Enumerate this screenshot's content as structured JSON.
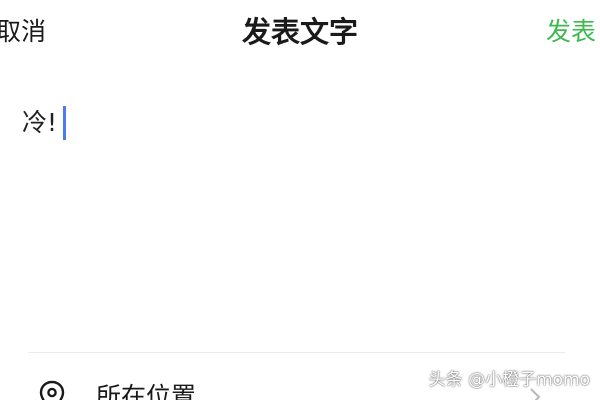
{
  "header": {
    "cancel_label": "取消",
    "title": "发表文字",
    "publish_label": "发表"
  },
  "editor": {
    "text": "冷!"
  },
  "location": {
    "label": "所在位置"
  },
  "watermark": {
    "text": "头条 @小橙子momo"
  },
  "colors": {
    "accent_green": "#3cb94f",
    "caret_blue": "#4a7cf0"
  },
  "icons": {
    "location": "location-pin-icon",
    "chevron": "chevron-right-icon"
  }
}
